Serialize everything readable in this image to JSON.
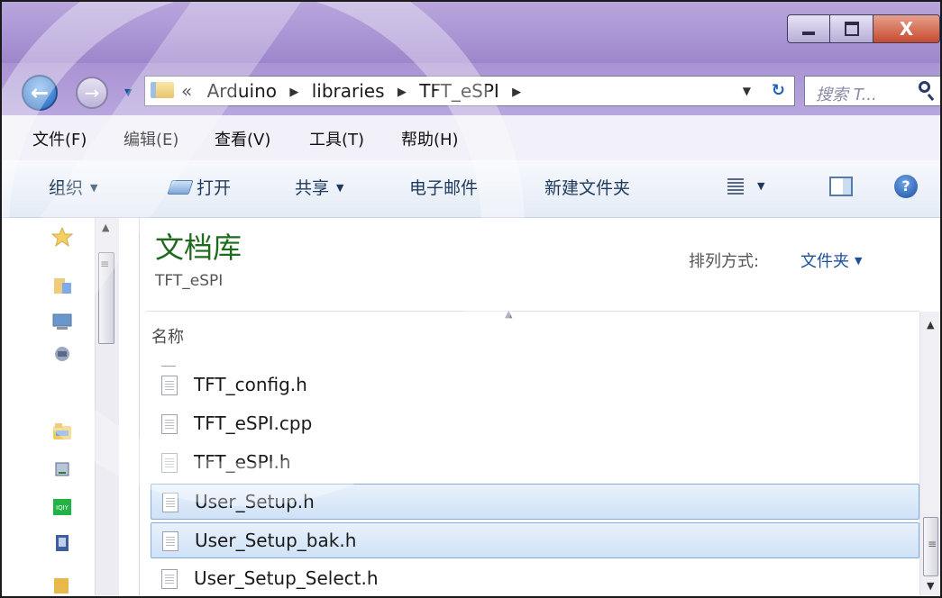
{
  "window": {
    "close_label": "X"
  },
  "nav": {
    "back_glyph": "←",
    "forward_glyph": "→",
    "history_caret": "▼"
  },
  "address": {
    "overflow": "«",
    "crumbs": [
      "Arduino",
      "libraries",
      "TFT_eSPI"
    ],
    "separator": "▶",
    "dropdown": "▼",
    "refresh": "↻"
  },
  "search": {
    "placeholder": "搜索 T..."
  },
  "menubar": {
    "items": [
      "文件(F)",
      "编辑(E)",
      "查看(V)",
      "工具(T)",
      "帮助(H)"
    ]
  },
  "toolbar": {
    "organize": "组织",
    "open": "打开",
    "share": "共享",
    "email": "电子邮件",
    "new_folder": "新建文件夹",
    "caret": "▼",
    "help": "?"
  },
  "library": {
    "title": "文档库",
    "subtitle": "TFT_eSPI",
    "arrange_label": "排列方式:",
    "arrange_value": "文件夹"
  },
  "filelist": {
    "column_name": "名称",
    "sort_indicator": "▲",
    "files": [
      {
        "name": "TFT_config.h",
        "selected": false
      },
      {
        "name": "TFT_eSPI.cpp",
        "selected": false
      },
      {
        "name": "TFT_eSPI.h",
        "selected": false
      },
      {
        "name": "User_Setup.h",
        "selected": true
      },
      {
        "name": "User_Setup_bak.h",
        "selected": true
      },
      {
        "name": "User_Setup_Select.h",
        "selected": false
      }
    ]
  },
  "scrollbar": {
    "up": "▲",
    "down": "▼",
    "grip": "≡"
  },
  "colors": {
    "title_bar": "#a994d4",
    "library_title": "#1e6b1e",
    "link": "#1e4f9c",
    "selection": "#cfe2f7",
    "close_button": "#c64a2e"
  },
  "icons": {
    "nav_pane": [
      "favorites-star-icon",
      "desktop-folder-icon",
      "computer-icon",
      "network-icon",
      "library-folder-icon",
      "drive-icon",
      "iqiyi-app-icon",
      "book-icon",
      "folder-icon"
    ]
  }
}
